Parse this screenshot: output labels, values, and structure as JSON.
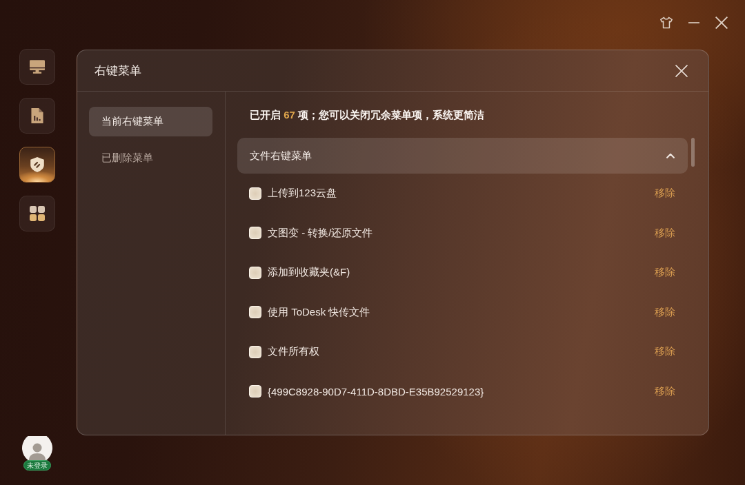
{
  "nav": {
    "items": [
      {
        "kind": "monitor",
        "selected": false
      },
      {
        "kind": "report",
        "selected": false
      },
      {
        "kind": "shield",
        "selected": true
      },
      {
        "kind": "apps",
        "selected": false
      }
    ]
  },
  "user": {
    "status": "未登录"
  },
  "dialog": {
    "title": "右键菜单",
    "tabs": [
      {
        "label": "当前右键菜单",
        "selected": true
      },
      {
        "label": "已删除菜单",
        "selected": false
      }
    ],
    "summary": {
      "prefix": "已开启",
      "count": "67",
      "suffix": "项；您可以关闭冗余菜单项，系统更简洁"
    },
    "group": {
      "title": "文件右键菜单",
      "expanded": true,
      "items": [
        {
          "label": "上传到123云盘",
          "checked": false,
          "action": "移除"
        },
        {
          "label": "文图变 - 转换/还原文件",
          "checked": false,
          "action": "移除"
        },
        {
          "label": "添加到收藏夹(&F)",
          "checked": false,
          "action": "移除"
        },
        {
          "label": "使用 ToDesk 快传文件",
          "checked": false,
          "action": "移除"
        },
        {
          "label": "文件所有权",
          "checked": false,
          "action": "移除"
        },
        {
          "label": "{499C8928-90D7-411D-8DBD-E35B92529123}",
          "checked": false,
          "action": "移除"
        }
      ]
    }
  }
}
